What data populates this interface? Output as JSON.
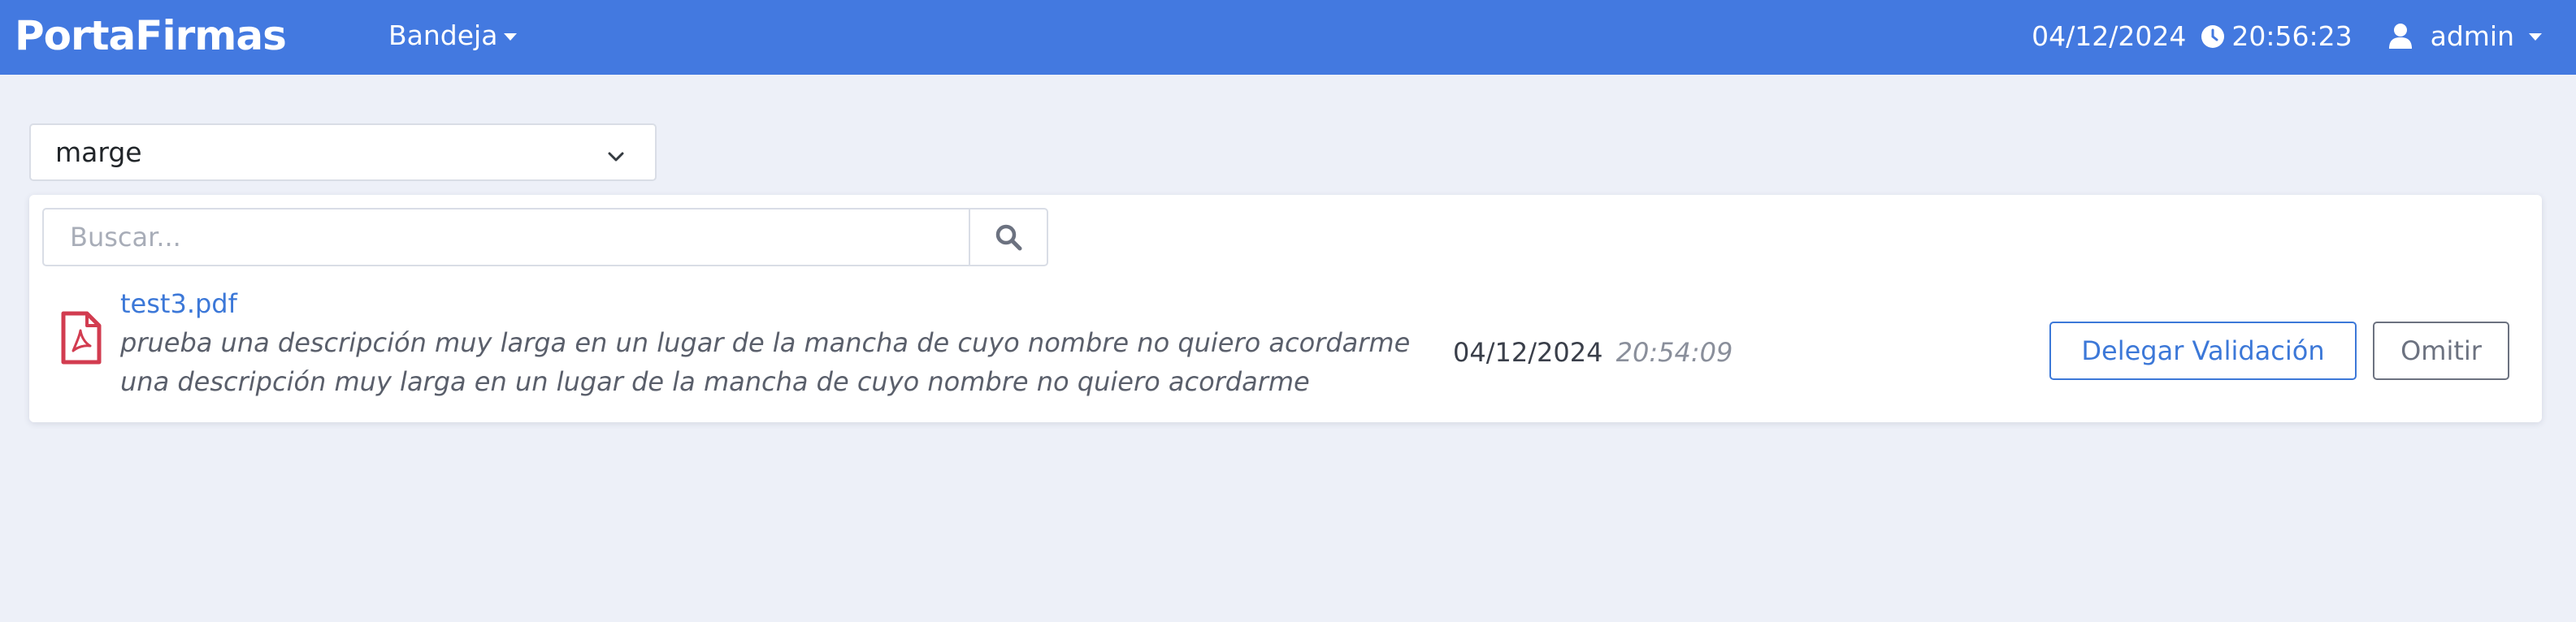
{
  "colors": {
    "navbar_bg": "#4379e0",
    "page_bg": "#edf0f8",
    "primary": "#3c78d8",
    "pdf_red": "#d23c50",
    "secondary": "#6c7280"
  },
  "navbar": {
    "brand": "PortaFirmas",
    "menu_label": "Bandeja",
    "date": "04/12/2024",
    "time": "20:56:23",
    "clock_icon": "clock-icon",
    "user_icon": "user-icon",
    "user_label": "admin"
  },
  "filter": {
    "selected_value": "marge",
    "icon": "chevron-down-icon"
  },
  "search": {
    "placeholder": "Buscar...",
    "value": "",
    "icon": "search-icon"
  },
  "documents": [
    {
      "icon": "pdf-file-icon",
      "name": "test3.pdf",
      "description": "prueba una descripción muy larga en un lugar de la mancha de cuyo nombre no quiero acordarme una descripción muy larga en un lugar de la mancha de cuyo nombre no quiero acordarme",
      "date": "04/12/2024",
      "time": "20:54:09",
      "actions": {
        "delegate_label": "Delegar Validación",
        "skip_label": "Omitir"
      }
    }
  ]
}
